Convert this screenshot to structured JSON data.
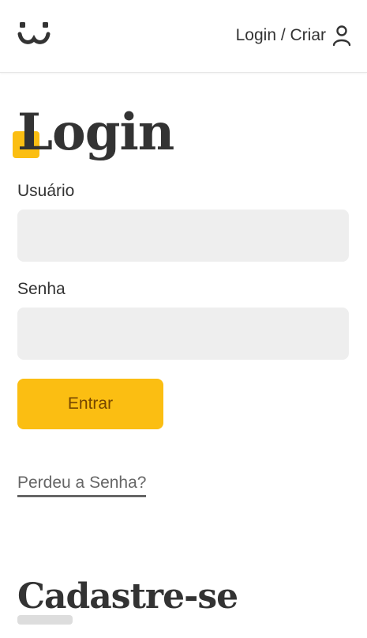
{
  "header": {
    "logo_icon": "dog-face-logo-icon",
    "login_link_label": "Login / Criar",
    "user_icon": "user-icon"
  },
  "main": {
    "title": "Login",
    "username": {
      "label": "Usuário",
      "value": ""
    },
    "password": {
      "label": "Senha",
      "value": ""
    },
    "submit_label": "Entrar",
    "lost_password_link": "Perdeu a Senha?",
    "signup_title": "Cadastre-se"
  },
  "colors": {
    "accent": "#fbbe12",
    "button_text": "#764701",
    "text": "#333333",
    "input_bg": "#eeeeee"
  }
}
